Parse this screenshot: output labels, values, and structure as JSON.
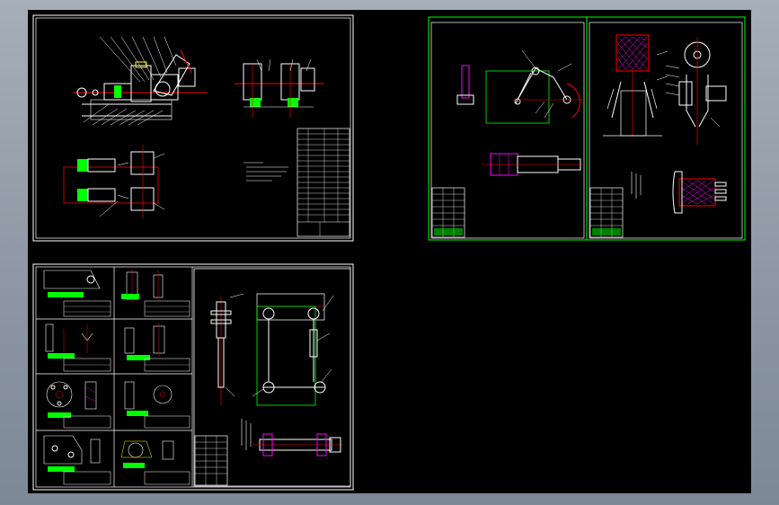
{
  "app": {
    "viewport_label": "",
    "colors": {
      "background": "#000000",
      "frame": "#ffffff",
      "green_frame": "#00ff00",
      "red_line": "#ff0000",
      "green_fill": "#00ff00",
      "magenta": "#ff00ff",
      "yellow": "#ffff00",
      "cyan": "#00ffff"
    }
  },
  "drawings": {
    "assembly_sheet": {
      "icon": "assembly-drawing-icon"
    },
    "arm_sheet": {
      "icon": "arm-linkage-drawing-icon"
    },
    "gripper_sheet": {
      "icon": "gripper-drawing-icon"
    },
    "parts_sheet": {
      "icon": "part-drawings-icon"
    },
    "linkage_sheet": {
      "icon": "linkage-drawing-icon"
    }
  }
}
